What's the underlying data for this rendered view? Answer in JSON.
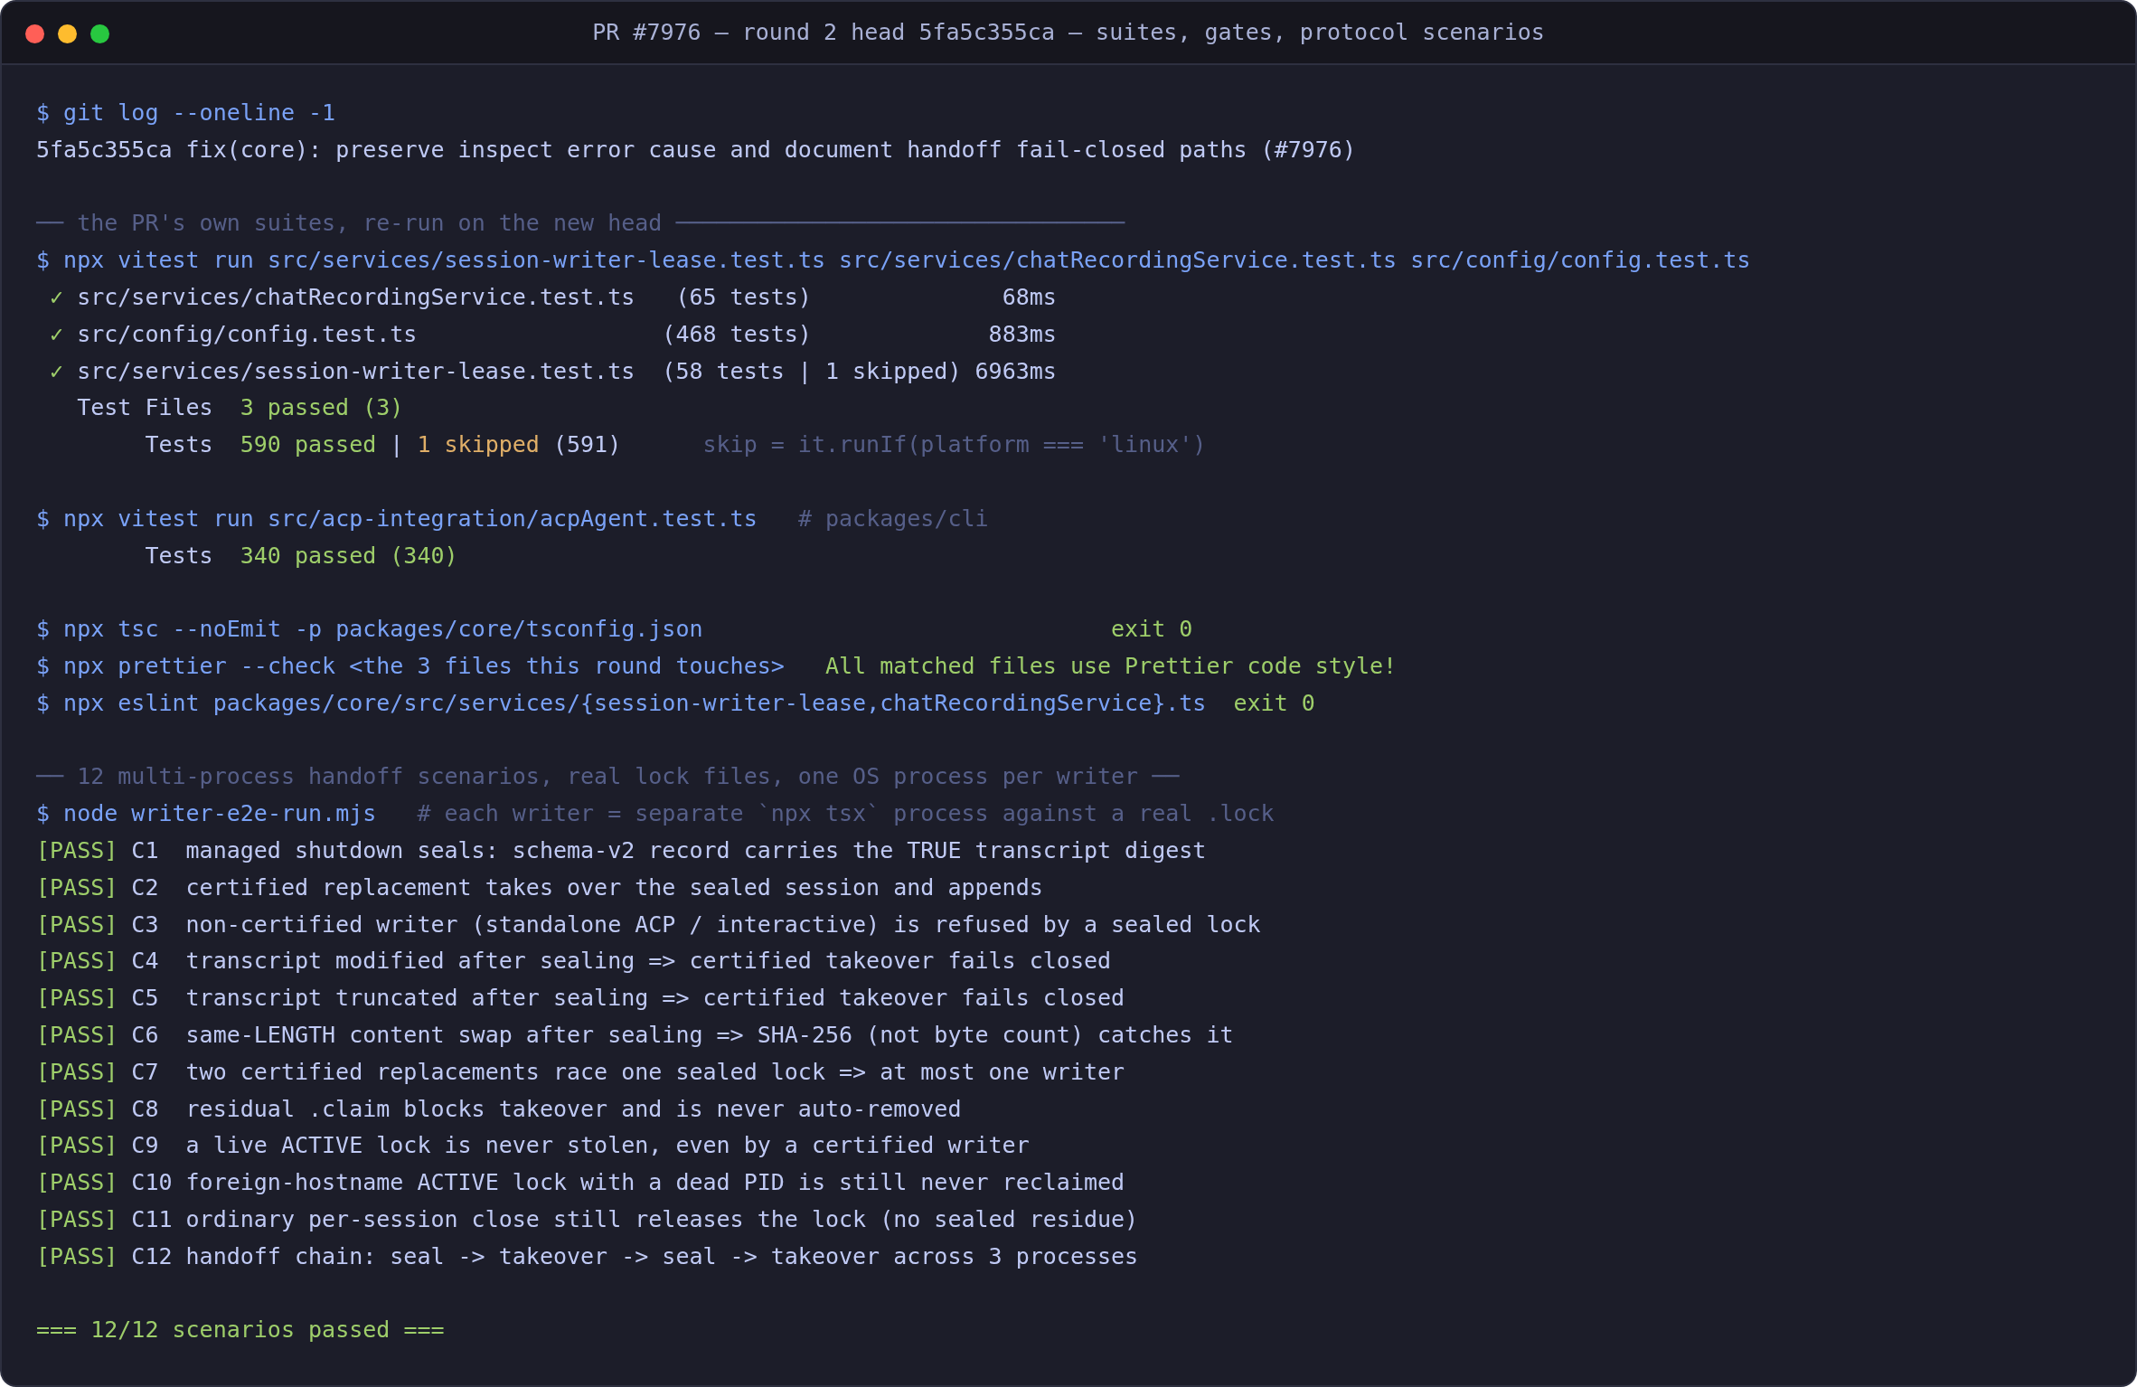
{
  "window": {
    "title": "PR #7976 — round 2 head 5fa5c355ca — suites, gates, protocol scenarios"
  },
  "lines": [
    {
      "kind": "command",
      "prompt": "$",
      "command": "git log --oneline -1"
    },
    {
      "kind": "output",
      "text": "5fa5c355ca fix(core): preserve inspect error cause and document handoff fail-closed paths (#7976)"
    },
    {
      "kind": "blank"
    },
    {
      "kind": "rule",
      "text": "── the PR's own suites, re-run on the new head ─────────────────────────────────"
    },
    {
      "kind": "command",
      "prompt": "$",
      "command": "npx vitest run src/services/session-writer-lease.test.ts src/services/chatRecordingService.test.ts src/config/config.test.ts"
    },
    {
      "kind": "suite",
      "mark": "✓",
      "file": "src/services/chatRecordingService.test.ts",
      "count": "(65 tests)",
      "time": "68ms"
    },
    {
      "kind": "suite",
      "mark": "✓",
      "file": "src/config/config.test.ts",
      "count": "(468 tests)",
      "time": "883ms"
    },
    {
      "kind": "suite",
      "mark": "✓",
      "file": "src/services/session-writer-lease.test.ts",
      "count": "(58 tests | 1 skipped)",
      "time": "6963ms"
    },
    {
      "kind": "summary",
      "label": "Test Files",
      "parts": [
        {
          "text": "3 passed",
          "kind": "pass"
        },
        {
          "text": "(3)",
          "kind": "pass"
        }
      ]
    },
    {
      "kind": "summary",
      "label": "Tests",
      "parts": [
        {
          "text": "590 passed",
          "kind": "pass"
        },
        {
          "text": "|",
          "kind": "plain"
        },
        {
          "text": "1 skipped",
          "kind": "skip"
        },
        {
          "text": "(591)",
          "kind": "plain"
        }
      ],
      "note": "skip = it.runIf(platform === 'linux')"
    },
    {
      "kind": "blank"
    },
    {
      "kind": "command",
      "prompt": "$",
      "command": "npx vitest run src/acp-integration/acpAgent.test.ts",
      "comment": "# packages/cli"
    },
    {
      "kind": "summary",
      "label": "Tests",
      "parts": [
        {
          "text": "340 passed",
          "kind": "pass"
        },
        {
          "text": "(340)",
          "kind": "pass"
        }
      ]
    },
    {
      "kind": "blank"
    },
    {
      "kind": "command",
      "prompt": "$",
      "command": "npx tsc --noEmit -p packages/core/tsconfig.json",
      "result": "exit 0"
    },
    {
      "kind": "command",
      "prompt": "$",
      "command": "npx prettier --check <the 3 files this round touches>",
      "result": "All matched files use Prettier code style!"
    },
    {
      "kind": "command",
      "prompt": "$",
      "command": "npx eslint packages/core/src/services/{session-writer-lease,chatRecordingService}.ts",
      "result": "exit 0"
    },
    {
      "kind": "blank"
    },
    {
      "kind": "rule",
      "text": "── 12 multi-process handoff scenarios, real lock files, one OS process per writer ──"
    },
    {
      "kind": "command",
      "prompt": "$",
      "command": "node writer-e2e-run.mjs",
      "comment": "# each writer = separate `npx tsx` process against a real .lock"
    },
    {
      "kind": "scenario",
      "status": "[PASS]",
      "id": "C1",
      "text": "managed shutdown seals: schema-v2 record carries the TRUE transcript digest"
    },
    {
      "kind": "scenario",
      "status": "[PASS]",
      "id": "C2",
      "text": "certified replacement takes over the sealed session and appends"
    },
    {
      "kind": "scenario",
      "status": "[PASS]",
      "id": "C3",
      "text": "non-certified writer (standalone ACP / interactive) is refused by a sealed lock"
    },
    {
      "kind": "scenario",
      "status": "[PASS]",
      "id": "C4",
      "text": "transcript modified after sealing => certified takeover fails closed"
    },
    {
      "kind": "scenario",
      "status": "[PASS]",
      "id": "C5",
      "text": "transcript truncated after sealing => certified takeover fails closed"
    },
    {
      "kind": "scenario",
      "status": "[PASS]",
      "id": "C6",
      "text": "same-LENGTH content swap after sealing => SHA-256 (not byte count) catches it"
    },
    {
      "kind": "scenario",
      "status": "[PASS]",
      "id": "C7",
      "text": "two certified replacements race one sealed lock => at most one writer"
    },
    {
      "kind": "scenario",
      "status": "[PASS]",
      "id": "C8",
      "text": "residual .claim blocks takeover and is never auto-removed"
    },
    {
      "kind": "scenario",
      "status": "[PASS]",
      "id": "C9",
      "text": "a live ACTIVE lock is never stolen, even by a certified writer"
    },
    {
      "kind": "scenario",
      "status": "[PASS]",
      "id": "C10",
      "text": "foreign-hostname ACTIVE lock with a dead PID is still never reclaimed"
    },
    {
      "kind": "scenario",
      "status": "[PASS]",
      "id": "C11",
      "text": "ordinary per-session close still releases the lock (no sealed residue)"
    },
    {
      "kind": "scenario",
      "status": "[PASS]",
      "id": "C12",
      "text": "handoff chain: seal -> takeover -> seal -> takeover across 3 processes"
    },
    {
      "kind": "blank"
    },
    {
      "kind": "banner",
      "text": "=== 12/12 scenarios passed ==="
    }
  ]
}
